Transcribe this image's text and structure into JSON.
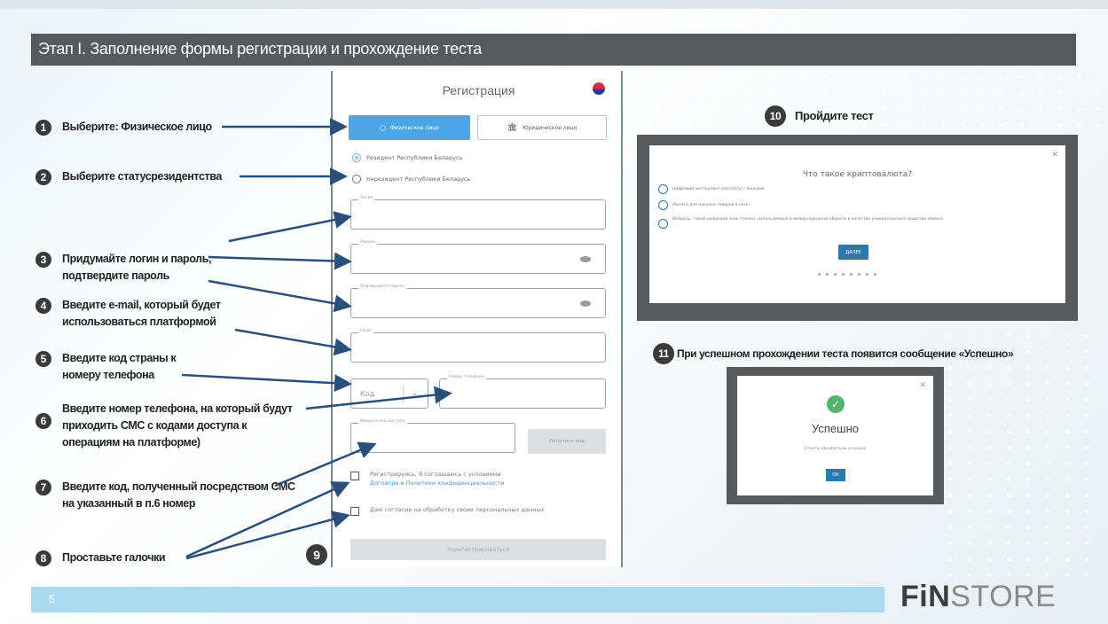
{
  "slide": {
    "title": "Этап I. Заполнение формы регистрации и прохождение теста",
    "page_number": "5",
    "logo_text": {
      "fin": "FiN",
      "store": "STORE"
    },
    "accent_color": "#2a78ad",
    "footer_bar_color": "#a8dbef",
    "title_bar_color": "#58595b"
  },
  "steps": [
    {
      "num": "1",
      "text": "Выберите: Физическое лицо"
    },
    {
      "num": "2",
      "text": "Выберите статусрезидентства"
    },
    {
      "num": "3",
      "text": "Придумайте логин и пароль, подтвердите пароль"
    },
    {
      "num": "4",
      "text": "Введите e-mail, который будет использоваться платформой"
    },
    {
      "num": "5",
      "text": "Введите код страны к номеру телефона"
    },
    {
      "num": "6",
      "text": "Введите номер телефона, на который будут приходить СМС с кодами доступа к операциям на платформе)"
    },
    {
      "num": "7",
      "text": "Введите код, полученный посредством СМС на указанный в п.6 номер"
    },
    {
      "num": "8",
      "text": "Проставьте галочки"
    },
    {
      "num": "9"
    }
  ],
  "form": {
    "title": "Регистрация",
    "btn_physical": "Физическое лицо",
    "btn_juridical": "Юридическое лицо",
    "radio_resident": "Резидент Республики Беларусь",
    "radio_nonresident": "Нерезидент Республики Беларусь",
    "label_login": "Логин",
    "label_password": "Пароль",
    "label_confirm": "Подтвердите пароль",
    "label_email": "Email",
    "code_placeholder": "Код",
    "label_phone": "Номер телефона",
    "label_sms": "Введите код доступа",
    "btn_get_code": "Получить код",
    "chk1_text": "Регистрируясь, Я соглашаюсь с условиями",
    "chk1_link1": "Договора",
    "chk1_and": " и ",
    "chk1_link2": "Политики конфиденциальности",
    "chk2_text": "Даю согласие на обработку своих персональных данных",
    "btn_register": "Зарегистрироваться"
  },
  "quiz": {
    "step_num": "10",
    "heading": "Пройдите тест",
    "question": "Что такое криптовалюта?",
    "options": [
      "Цифровой инструмент расплаты с банками",
      "Монета для покупки товаров в сети",
      "Вопросы, такой цифровой знак (токен), используемый в международном обороте в качестве универсального средства обмена"
    ],
    "next_label": "ДАЛЕЕ"
  },
  "success": {
    "step_num": "11",
    "heading": "При успешном прохождении теста появится сообщение «Успешно»",
    "title": "Успешно",
    "subtitle": "Ответы обработаны успешно",
    "ok_label": "ОК"
  }
}
